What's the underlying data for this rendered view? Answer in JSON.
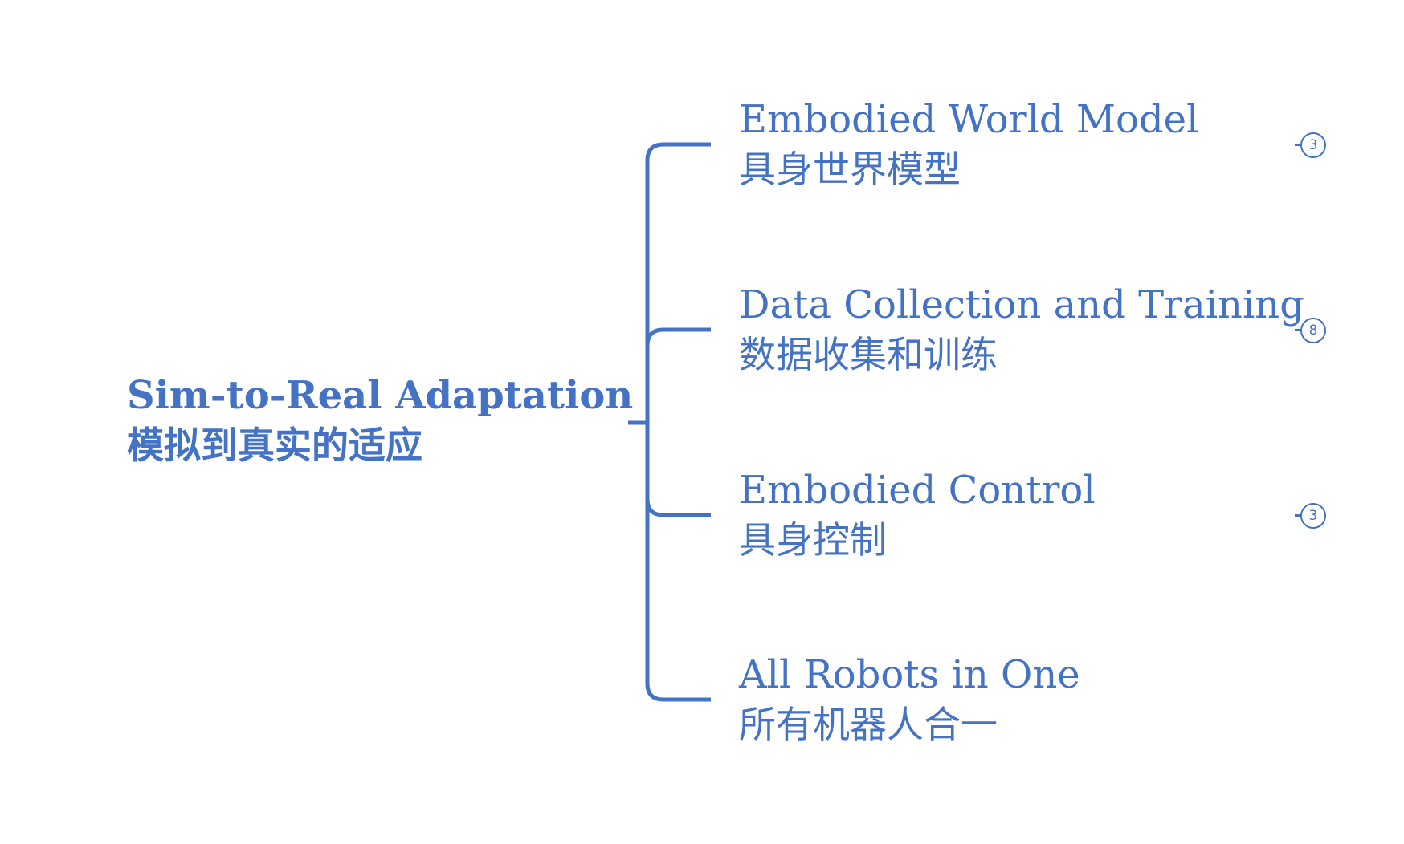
{
  "root": {
    "title_en": "Sim-to-Real Adaptation",
    "title_zh": "模拟到真实的适应"
  },
  "branches": [
    {
      "title_en": "Embodied World Model",
      "title_zh": "具身世界模型",
      "collapsed_count": "3"
    },
    {
      "title_en": "Data Collection and Training",
      "title_zh": "数据收集和训练",
      "collapsed_count": "8"
    },
    {
      "title_en": "Embodied Control",
      "title_zh": "具身控制",
      "collapsed_count": "3"
    },
    {
      "title_en": "All Robots in One",
      "title_zh": "所有机器人合一"
    }
  ],
  "colors": {
    "accent": "#4472c4",
    "background": "#ffffff"
  }
}
